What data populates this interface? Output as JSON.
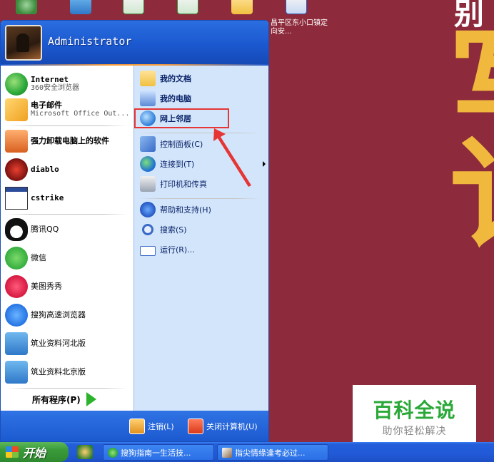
{
  "desktop": {
    "icon_label": "昌平区东小口镇定向安...",
    "bg_glyphs": {
      "g1": "别",
      "g2": "写",
      "g3": "讠"
    }
  },
  "start_menu": {
    "username": "Administrator",
    "pinned": [
      {
        "title": "Internet",
        "subtitle": "360安全浏览器"
      },
      {
        "title": "电子邮件",
        "subtitle": "Microsoft Office Out..."
      }
    ],
    "recent": [
      {
        "label": "强力卸载电脑上的软件"
      },
      {
        "label": "diablo"
      },
      {
        "label": "cstrike"
      },
      {
        "label": "腾讯QQ"
      },
      {
        "label": "微信"
      },
      {
        "label": "美图秀秀"
      },
      {
        "label": "搜狗高速浏览器"
      },
      {
        "label": "筑业资料河北版"
      },
      {
        "label": "筑业资料北京版"
      }
    ],
    "all_programs": "所有程序(P)",
    "right": [
      {
        "label": "我的文档"
      },
      {
        "label": "我的电脑"
      },
      {
        "label": "网上邻居"
      },
      {
        "label": "控制面板(C)"
      },
      {
        "label": "连接到(T)"
      },
      {
        "label": "打印机和传真"
      },
      {
        "label": "帮助和支持(H)"
      },
      {
        "label": "搜索(S)"
      },
      {
        "label": "运行(R)..."
      }
    ],
    "footer": {
      "logoff": "注销(L)",
      "shutdown": "关闭计算机(U)"
    }
  },
  "taskbar": {
    "start_label": "开始",
    "tasks": [
      {
        "label": "搜狗指南一生活技..."
      },
      {
        "label": "指尖情缘逢考必过..."
      }
    ]
  },
  "watermark": {
    "title": "百科全说",
    "subtitle": "助你轻松解决"
  },
  "colors": {
    "accent": "#1b58cf",
    "highlight": "#e53535",
    "watermark_green": "#2aa838"
  }
}
